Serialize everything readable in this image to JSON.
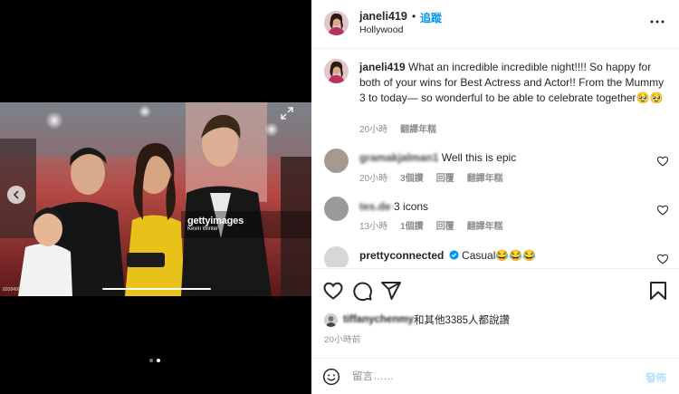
{
  "post": {
    "header": {
      "username": "janeli419",
      "separator": "•",
      "follow_label": "追蹤",
      "location": "Hollywood"
    },
    "caption": {
      "username": "janeli419",
      "text": "What an incredible incredible night!!!! So happy for both of your wins for Best Actress and Actor!! From the Mummy 3 to today— so wonderful to be able to celebrate together🥹🥹",
      "time": "20小時",
      "translate_label": "翻譯年糕"
    },
    "comments": [
      {
        "username": "gramakjalman1",
        "text": "Well this is epic",
        "time": "20小時",
        "likes": "3個讚",
        "reply_label": "回覆",
        "translate_label": "翻譯年糕"
      },
      {
        "username": "tes.de",
        "text": "3 icons",
        "time": "13小時",
        "likes": "1個讚",
        "reply_label": "回覆",
        "translate_label": "翻譯年糕"
      },
      {
        "username": "prettyconnected",
        "text": "Casual😂😂😂"
      }
    ],
    "likes_line": {
      "liker": "tiffanychenmy",
      "rest": "和其他3385人都說讚"
    },
    "time_ago": "20小時前",
    "composer": {
      "placeholder": "留言……",
      "post_label": "發佈"
    },
    "media": {
      "watermark_brand": "gettyimages",
      "watermark_credit": "Kevin Winter",
      "photo_id": "82084000",
      "slide_count": 2,
      "active_slide": 2
    },
    "icons": [
      "more-icon",
      "heart-icon",
      "comment-icon",
      "share-icon",
      "save-icon",
      "emoji-icon",
      "verified-icon",
      "expand-icon",
      "chevron-left-icon"
    ],
    "colors": {
      "accent": "#0095f6",
      "accent_disabled": "#b2dffc",
      "muted": "#8e8e8e",
      "text": "#262626"
    }
  }
}
